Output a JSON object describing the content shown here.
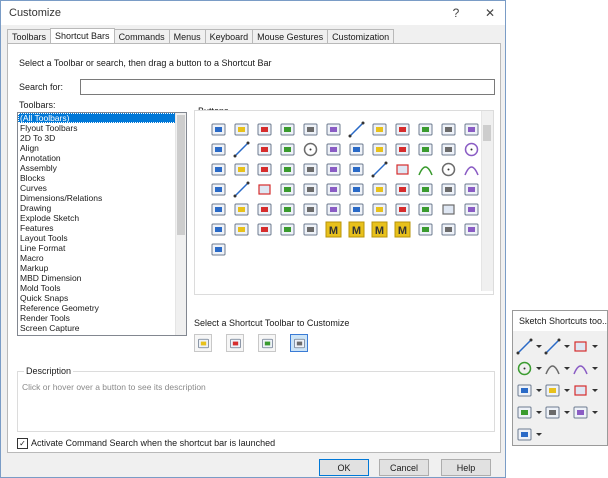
{
  "window": {
    "title": "Customize",
    "help_glyph": "?",
    "close_glyph": "✕"
  },
  "tabs": [
    "Toolbars",
    "Shortcut Bars",
    "Commands",
    "Menus",
    "Keyboard",
    "Mouse Gestures",
    "Customization"
  ],
  "active_tab": "Shortcut Bars",
  "instruction": "Select a Toolbar or search, then drag a button to a Shortcut Bar",
  "search": {
    "label": "Search for:",
    "value": ""
  },
  "toolbars": {
    "label": "Toolbars:",
    "items": [
      "(All Toolbars)",
      "Flyout Toolbars",
      "2D To 3D",
      "Align",
      "Annotation",
      "Assembly",
      "Blocks",
      "Curves",
      "Dimensions/Relations",
      "Drawing",
      "Explode Sketch",
      "Features",
      "Layout Tools",
      "Line Format",
      "Macro",
      "Markup",
      "MBD Dimension",
      "Mold Tools",
      "Quick Snaps",
      "Reference Geometry",
      "Render Tools",
      "Screen Capture"
    ],
    "selected": "(All Toolbars)"
  },
  "buttons_panel": {
    "label": "Buttons",
    "icons": [
      "pick-icon",
      "annotation-icon",
      "text-icon",
      "part-icon",
      "note-icon",
      "sketch-text-icon",
      "spline-on-surface-icon",
      "crosshair-icon",
      "layout-icon",
      "linked-icon",
      "model-icon",
      "bom-icon",
      "plane-icon",
      "line-format-icon",
      "file-icon",
      "view-icon",
      "hole-icon",
      "appearance-icon",
      "camera-icon",
      "filter-icon",
      "display-icon",
      "drawing-icon",
      "render-icon",
      "globe-icon",
      "pencil-icon",
      "solidworks-icon",
      "macro-icon",
      "section-icon",
      "print-icon",
      "settings-icon",
      "corner-icon",
      "diagonal-line-icon",
      "rectangle-icon",
      "slot-icon",
      "circle-icon",
      "arc-icon",
      "ellipse-icon",
      "centerline-icon",
      "box-icon",
      "trim-icon",
      "move-icon",
      "mirror-icon",
      "origin-icon",
      "sketch-icon",
      "extrude-icon",
      "cut-icon",
      "fillet-icon",
      "chamfer-icon",
      "shell-icon",
      "rib-icon",
      "draft-icon",
      "wrap-icon",
      "convert-icon",
      "font-icon",
      "monitor-icon",
      "check-icon",
      "bolt-icon",
      "flag-icon",
      "cube-icon",
      "gear-icon",
      "width-icon",
      "color-icon",
      "assembly-icon",
      "ruler-icon",
      "motion-icon",
      "macro-m-icon",
      "macro-m-icon",
      "macro-m-icon",
      "macro-m-icon",
      "graph-icon",
      "home-icon",
      "page-icon",
      "forward-icon"
    ]
  },
  "shortcut_toolbar": {
    "label": "Select a Shortcut Toolbar to Customize",
    "options": [
      "part-shortcut-icon",
      "assembly-shortcut-icon",
      "drawing-shortcut-icon",
      "sketch-shortcut-icon"
    ],
    "selected_index": 3
  },
  "description": {
    "label": "Description",
    "hint": "Click or hover over a button to see its description"
  },
  "activate_search": {
    "label": "Activate Command Search when the shortcut bar is launched",
    "checked": true
  },
  "actions": {
    "ok": "OK",
    "cancel": "Cancel",
    "help": "Help"
  },
  "flyout": {
    "title": "Sketch Shortcuts too...",
    "icons": [
      "line-icon",
      "centerline-icon",
      "rectangle-icon",
      "circle-icon",
      "arc-icon",
      "slot-icon",
      "convert-icon",
      "corner-icon",
      "box-icon",
      "mirror-icon",
      "move-icon",
      "extrude-icon",
      "plane-icon"
    ]
  },
  "colors": {
    "selection": "#0078d7",
    "accent_blue": "#2a6ac7",
    "accent_yellow": "#e8c11c",
    "accent_red": "#d62d2d",
    "accent_green": "#3a9b2f"
  }
}
